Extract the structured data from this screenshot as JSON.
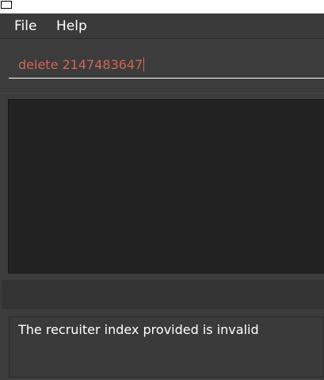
{
  "menu": {
    "file_label": "File",
    "help_label": "Help"
  },
  "command_box": {
    "value": "delete 2147483647"
  },
  "result_display": {
    "text": "The recruiter index provided is invalid"
  },
  "colors": {
    "error_text": "#d06651",
    "background": "#3b3b3b",
    "list_panel": "#222222"
  },
  "icons": [
    "window-icon"
  ]
}
